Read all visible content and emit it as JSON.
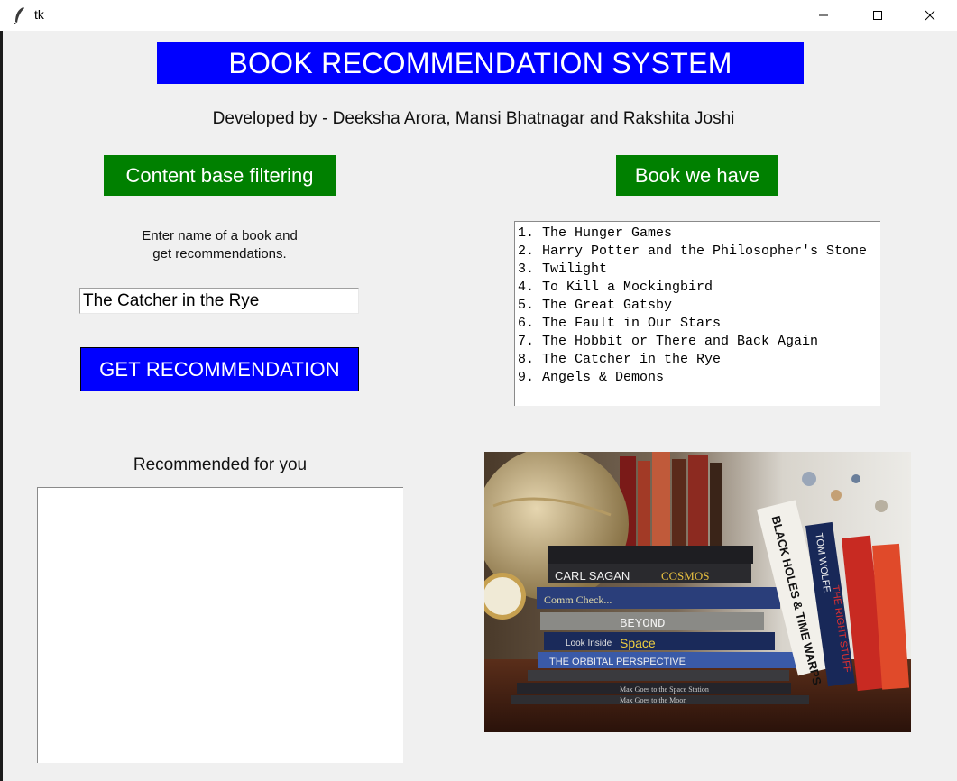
{
  "window": {
    "title": "tk",
    "minimize_glyph": "—",
    "maximize_glyph": "☐",
    "close_glyph": "✕"
  },
  "header": {
    "title": "BOOK RECOMMENDATION SYSTEM",
    "credits": "Developed by - Deeksha Arora, Mansi Bhatnagar and Rakshita Joshi"
  },
  "left_panel": {
    "content_filter_label": "Content base filtering",
    "instructions_line1": "Enter name of a book and",
    "instructions_line2": "get recommendations.",
    "book_input_value": "The Catcher in the Rye",
    "get_button_label": "GET RECOMMENDATION",
    "recommended_label": "Recommended for you"
  },
  "right_panel": {
    "books_button_label": "Book we have",
    "books": [
      "1. The Hunger Games",
      "2. Harry Potter and the Philosopher's Stone",
      "3. Twilight",
      "4. To Kill a Mockingbird",
      "5. The Great Gatsby",
      "6. The Fault in Our Stars",
      "7. The Hobbit or There and Back Again",
      "8. The Catcher in the Rye",
      "9. Angels & Demons"
    ]
  },
  "photo": {
    "spine_texts": [
      "CARL SAGAN",
      "COSMOS",
      "Comm Check...",
      "BEYOND",
      "Look Inside",
      "Space",
      "THE ORBITAL PERSPECTIVE",
      "Max Goes to the Space Station",
      "Max Goes to the Moon",
      "BLACK HOLES & TIME WARPS",
      "TOM WOLFE",
      "THE RIGHT STUFF"
    ]
  },
  "colors": {
    "title_bg": "#0000ff",
    "green_button": "#008000",
    "blue_button": "#0000ff",
    "window_bg": "#f0f0f0"
  }
}
